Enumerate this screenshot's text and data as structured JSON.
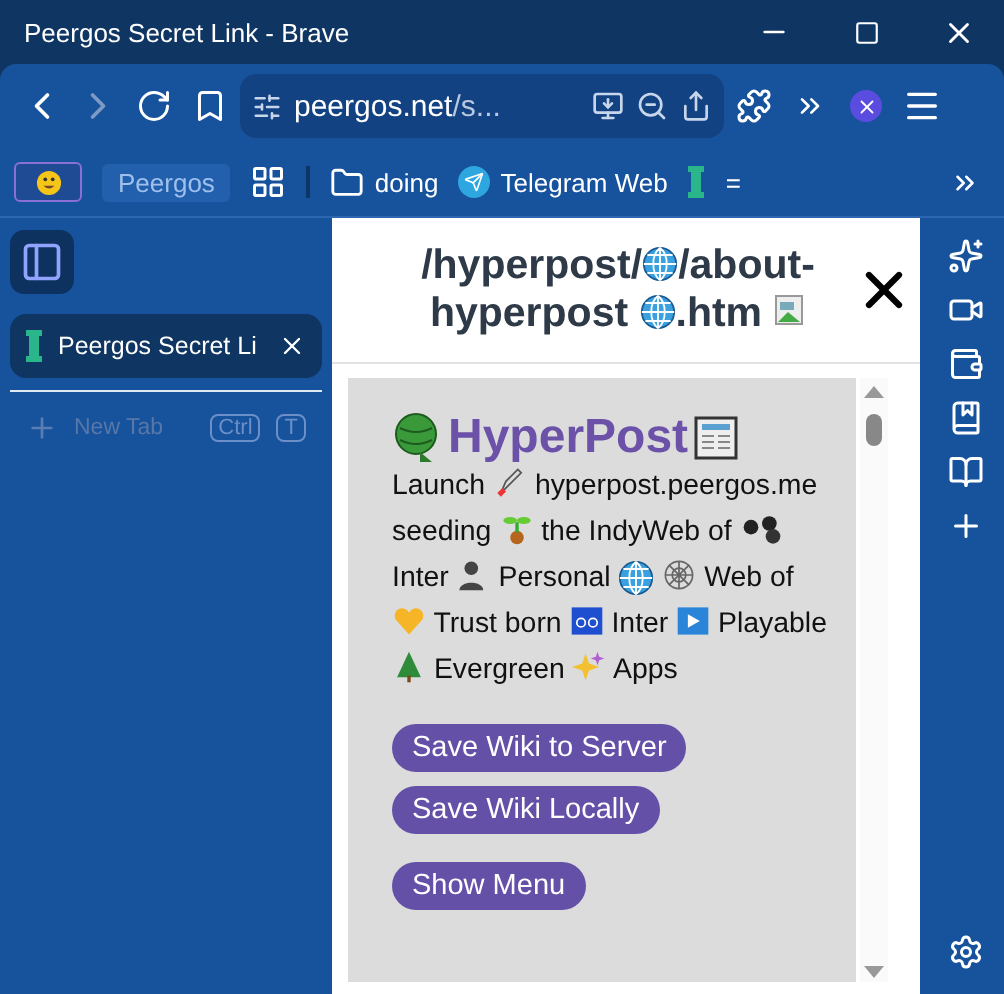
{
  "window": {
    "title": "Peergos Secret Link - Brave"
  },
  "address_bar": {
    "host": "peergos.net",
    "path": "/s..."
  },
  "bookmarks": [
    {
      "kind": "emoji"
    },
    {
      "kind": "chip",
      "label": "Peergos"
    },
    {
      "kind": "apps"
    },
    {
      "kind": "folder",
      "label": "doing"
    },
    {
      "kind": "telegram",
      "label": "Telegram Web"
    },
    {
      "kind": "peergos",
      "label": "="
    }
  ],
  "tabs": [
    {
      "title": "Peergos Secret Li",
      "selected": true
    }
  ],
  "new_tab": {
    "label": "New Tab",
    "keys": [
      "Ctrl",
      "T"
    ]
  },
  "viewer": {
    "title": [
      {
        "kind": "text",
        "text": "/hyperpost/"
      },
      {
        "kind": "globe"
      },
      {
        "kind": "text",
        "text": "/about-"
      },
      {
        "kind": "break"
      },
      {
        "kind": "text",
        "text": "hyperpost "
      },
      {
        "kind": "globe"
      },
      {
        "kind": "text",
        "text": ".htm"
      },
      {
        "kind": "broken-image"
      }
    ],
    "heading": "HyperPost",
    "intro": [
      {
        "kind": "text",
        "text": "Launch"
      },
      {
        "kind": "icon"
      },
      {
        "kind": "text",
        "text": "hyperpost.peergos.me"
      },
      {
        "kind": "text",
        "text": "seeding"
      },
      {
        "kind": "icon"
      },
      {
        "kind": "text",
        "text": "the IndyWeb of"
      },
      {
        "kind": "icon"
      },
      {
        "kind": "text",
        "text": "Inter"
      },
      {
        "kind": "icon"
      },
      {
        "kind": "text",
        "text": "Personal"
      },
      {
        "kind": "icon"
      },
      {
        "kind": "icon"
      },
      {
        "kind": "text",
        "text": "Web of"
      },
      {
        "kind": "icon"
      },
      {
        "kind": "text",
        "text": "Trust born"
      },
      {
        "kind": "icon"
      },
      {
        "kind": "text",
        "text": "Inter"
      },
      {
        "kind": "icon"
      },
      {
        "kind": "text",
        "text": "Playable"
      },
      {
        "kind": "icon"
      },
      {
        "kind": "text",
        "text": "Evergreen"
      },
      {
        "kind": "icon"
      },
      {
        "kind": "text",
        "text": "Apps"
      }
    ],
    "buttons": [
      "Save Wiki to Server",
      "Save Wiki Locally",
      "Show Menu"
    ]
  }
}
